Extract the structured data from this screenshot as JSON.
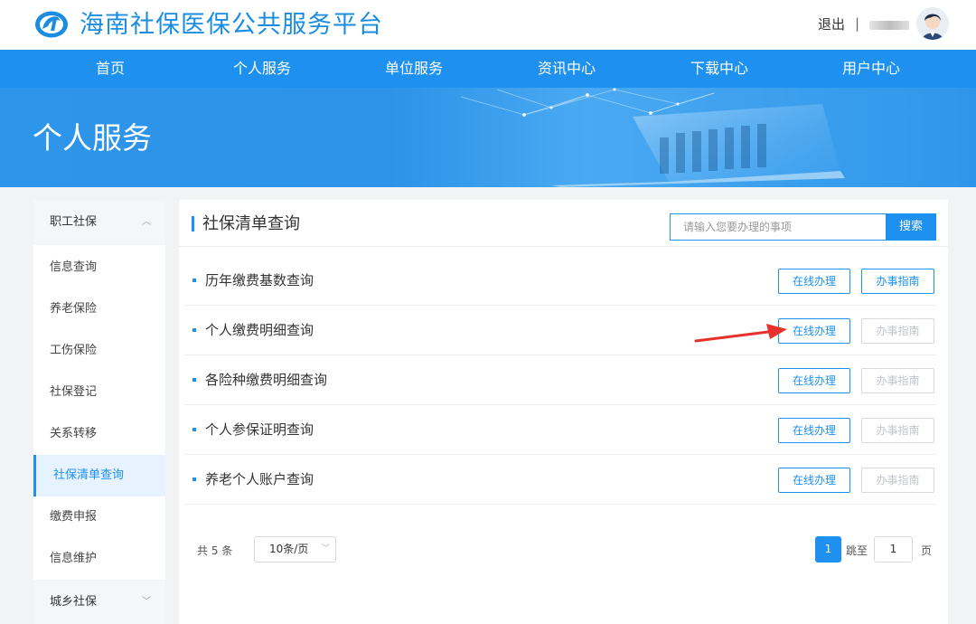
{
  "header": {
    "site_title": "海南社保医保公共服务平台",
    "logout": "退出",
    "separator": "|"
  },
  "nav": {
    "items": [
      "首页",
      "个人服务",
      "单位服务",
      "资讯中心",
      "下载中心",
      "用户中心"
    ]
  },
  "banner": {
    "title": "个人服务"
  },
  "sidebar": {
    "group_top": "职工社保",
    "items": [
      "信息查询",
      "养老保险",
      "工伤保险",
      "社保登记",
      "关系转移",
      "社保清单查询",
      "缴费申报",
      "信息维护"
    ],
    "active_item": "社保清单查询",
    "group_bottom": "城乡社保"
  },
  "panel": {
    "title": "社保清单查询",
    "search_placeholder": "请输入您要办理的事项",
    "search_button": "搜索",
    "rows": [
      {
        "label": "历年缴费基数查询",
        "online": "在线办理",
        "guide": "办事指南",
        "guide_enabled": true
      },
      {
        "label": "个人缴费明细查询",
        "online": "在线办理",
        "guide": "办事指南",
        "guide_enabled": false
      },
      {
        "label": "各险种缴费明细查询",
        "online": "在线办理",
        "guide": "办事指南",
        "guide_enabled": false
      },
      {
        "label": "个人参保证明查询",
        "online": "在线办理",
        "guide": "办事指南",
        "guide_enabled": false
      },
      {
        "label": "养老个人账户查询",
        "online": "在线办理",
        "guide": "办事指南",
        "guide_enabled": false
      }
    ]
  },
  "pagination": {
    "total": "共 5 条",
    "page_size": "10条/页",
    "current_page": "1",
    "jump_label": "跳至",
    "jump_value": "1",
    "page_unit": "页"
  },
  "colors": {
    "brand": "#1e90f0",
    "annotation_arrow": "#e8312a"
  }
}
